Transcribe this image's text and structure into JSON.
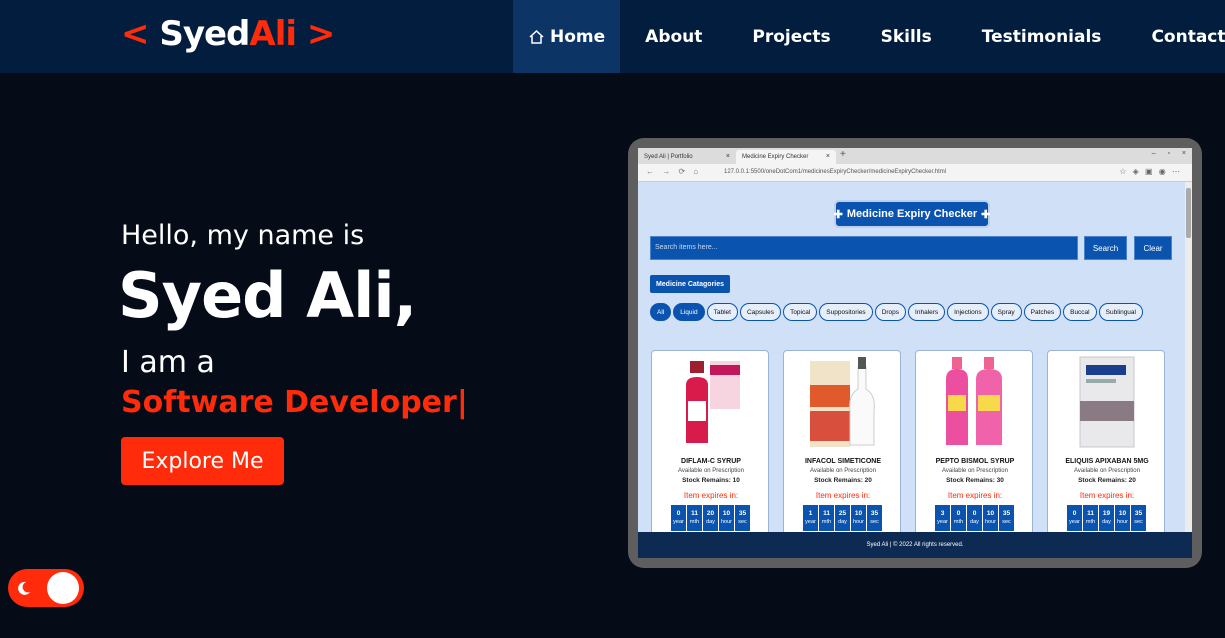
{
  "header": {
    "logo": {
      "open": "<",
      "first": "Syed",
      "last": "Ali",
      "close": ">"
    },
    "nav": [
      {
        "label": "Home",
        "icon": "home-icon",
        "active": true
      },
      {
        "label": "About"
      },
      {
        "label": "Projects"
      },
      {
        "label": "Skills"
      },
      {
        "label": "Testimonials"
      },
      {
        "label": "Contact"
      }
    ]
  },
  "hero": {
    "greeting": "Hello, my name is",
    "name": "Syed Ali,",
    "intro": "I am a",
    "role": "Software Developer|",
    "cta": "Explore Me"
  },
  "theme_toggle": {
    "icon": "moon-icon"
  },
  "preview": {
    "browser": {
      "tab1": "Syed Ali | Portfolio",
      "tab2": "Medicine Expiry Checker",
      "url": "127.0.0.1:5500/oneDotCom1/medicinesExpiryChecker/medicineExpiryChecker.html"
    },
    "app": {
      "title": "Medicine Expiry Checker",
      "search_placeholder": "Search items here...",
      "search_button": "Search",
      "clear_button": "Clear",
      "categories_label": "Medicine Catagories",
      "categories": [
        "All",
        "Liquid",
        "Tablet",
        "Capsules",
        "Topical",
        "Suppositories",
        "Drops",
        "Inhalers",
        "Injections",
        "Spray",
        "Patches",
        "Buccal",
        "Sublingual"
      ],
      "products": [
        {
          "name": "DIFLAM-C SYRUP",
          "availability": "Available on Prescription",
          "stock": "Stock Remains: 10",
          "expires": "Item expires in:",
          "timer": [
            "0",
            "11",
            "20",
            "10",
            "35"
          ]
        },
        {
          "name": "INFACOL SIMETICONE",
          "availability": "Available on Prescription",
          "stock": "Stock Remains: 20",
          "expires": "Item expires in:",
          "timer": [
            "1",
            "11",
            "25",
            "10",
            "35"
          ]
        },
        {
          "name": "PEPTO BISMOL SYRUP",
          "availability": "Available on Prescription",
          "stock": "Stock Remains: 30",
          "expires": "Item expires in:",
          "timer": [
            "3",
            "0",
            "0",
            "10",
            "35"
          ]
        },
        {
          "name": "ELIQUIS APIXABAN 5MG",
          "availability": "Available on Prescription",
          "stock": "Stock Remains: 20",
          "expires": "Item expires in:",
          "timer": [
            "0",
            "11",
            "19",
            "10",
            "35"
          ]
        }
      ],
      "timer_units": [
        "year",
        "mth",
        "day",
        "hour",
        "sec"
      ],
      "footer": "Syed Ali | © 2022 All rights reserved."
    }
  },
  "colors": {
    "accent": "#ff2b0a",
    "nav_bg": "#021d3d",
    "page_bg": "#050c18",
    "app_blue": "#0a54b0"
  }
}
